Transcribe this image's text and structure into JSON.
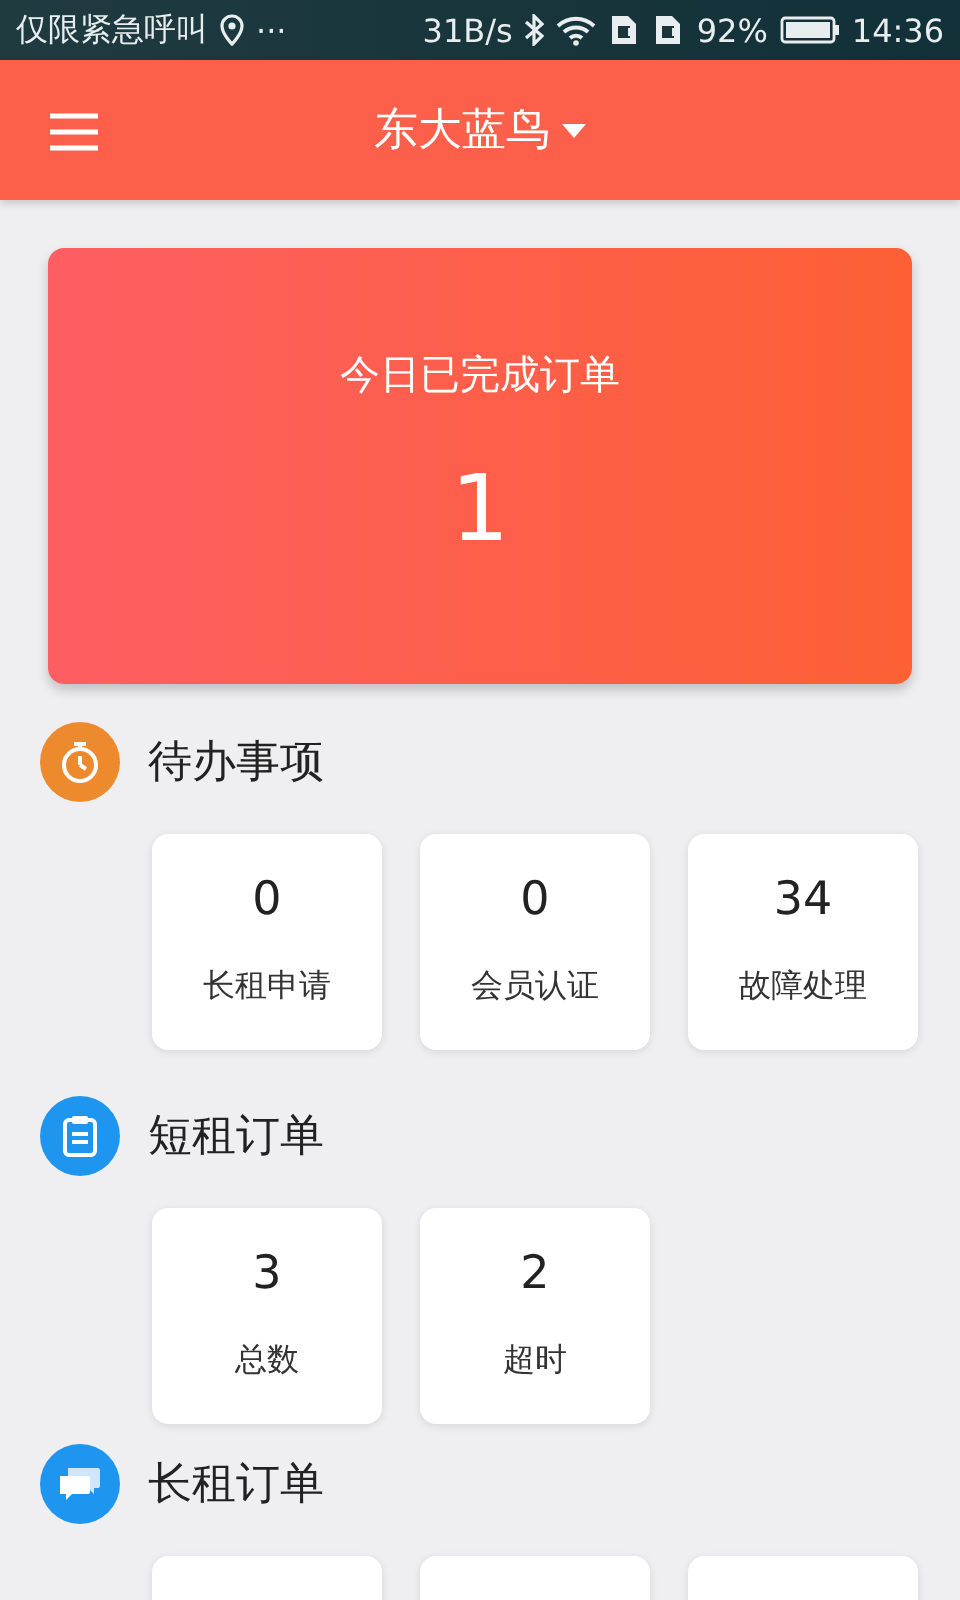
{
  "status_bar": {
    "carrier": "仅限紧急呼叫",
    "more": "···",
    "speed": "31B/s",
    "battery": "92%",
    "time": "14:36"
  },
  "header": {
    "title": "东大蓝鸟"
  },
  "summary": {
    "label": "今日已完成订单",
    "value": "1"
  },
  "sections": [
    {
      "title": "待办事项",
      "color": "#ee8a2e",
      "cards": [
        {
          "kind": "stat",
          "value": "0",
          "label": "长租申请"
        },
        {
          "kind": "stat",
          "value": "0",
          "label": "会员认证"
        },
        {
          "kind": "stat",
          "value": "34",
          "label": "故障处理"
        }
      ]
    },
    {
      "title": "短租订单",
      "color": "#1e96f0",
      "cards": [
        {
          "kind": "stat",
          "value": "3",
          "label": "总数"
        },
        {
          "kind": "stat",
          "value": "2",
          "label": "超时"
        }
      ]
    },
    {
      "title": "长租订单",
      "color": "#1e96f0",
      "cards": [
        {
          "kind": "cut"
        },
        {
          "kind": "cut"
        },
        {
          "kind": "cut"
        }
      ]
    }
  ]
}
